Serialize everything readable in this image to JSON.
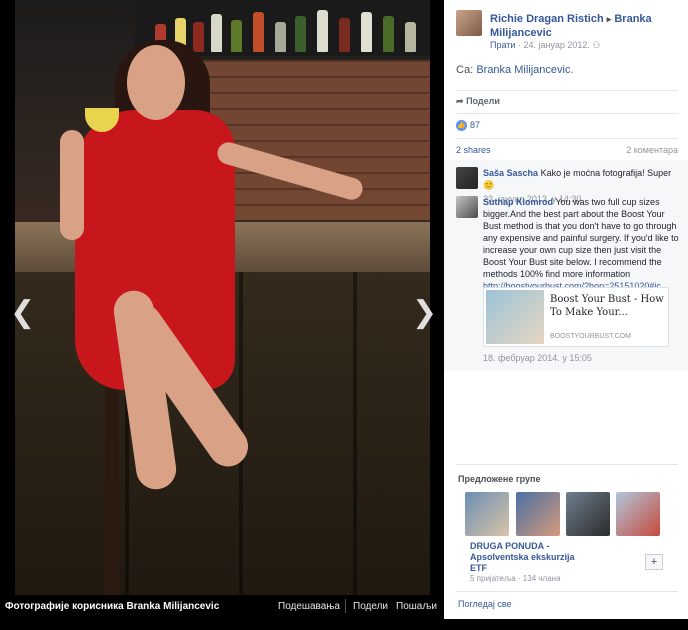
{
  "photo": {
    "footer_title": "Фотографије корисника Branka Milijancevic",
    "actions": [
      "Подешавања",
      "Подели",
      "Пошаљи"
    ]
  },
  "post": {
    "author": "Richie Dragan Ristich",
    "arrow": "▸",
    "target": "Branka Milijancevic",
    "follow": "Прати",
    "date": "24. јануар 2012.",
    "with_prefix": "Са:",
    "with_name": "Branka Milijancevic.",
    "share_action": "Подели",
    "likes": "87",
    "shares": "2 shares",
    "comments_count": "2 коментара"
  },
  "comments": [
    {
      "name": "Saša Sascha",
      "text": "Kako je moćna fotografija! Super",
      "emoji": "🙂",
      "time": "23. јануар 2013. у 14:30"
    },
    {
      "name": "Suthap Klomrod",
      "text": "You was two full cup sizes bigger.And the best part about the Boost Your Bust method is that you don't have to go through any expensive and painful surgery. If you'd like to increase your own cup size then just visit the Boost Your Bust site below. I recommend the methods 100% find more information",
      "link": "http://boostyourbust.com/?hop=25151020#ic",
      "preview_title": "Boost Your Bust - How To Make Your...",
      "preview_domain": "BOOSTYOURBUST.COM",
      "time": "18. фебруар 2014. у 15:05"
    }
  ],
  "groups": {
    "title": "Предложене групе",
    "name": "DRUGA PONUDA - Apsolventska ekskurzija ETF",
    "meta": "5 пријатеља · 134 члана",
    "add": "+",
    "see_all": "Погледај све"
  },
  "colors": {
    "link": "#365899",
    "dress": "#c8161d",
    "like_badge": "#5890ff"
  }
}
